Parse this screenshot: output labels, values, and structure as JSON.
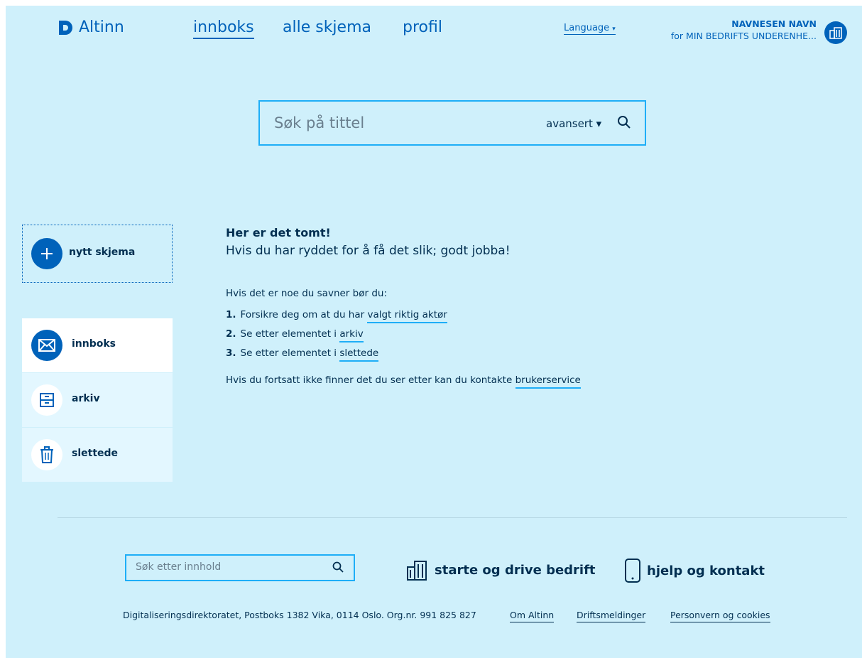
{
  "header": {
    "logo": "Altinn",
    "nav": [
      {
        "label": "innboks",
        "active": true
      },
      {
        "label": "alle skjema",
        "active": false
      },
      {
        "label": "profil",
        "active": false
      }
    ],
    "language": "Language",
    "user_name": "NAVNESEN NAVN",
    "user_org": "for MIN BEDRIFTS UNDERENHE..."
  },
  "search": {
    "placeholder": "Søk på tittel",
    "advanced": "avansert ▾"
  },
  "sidebar": {
    "new_form": "nytt skjema",
    "items": [
      {
        "label": "innboks",
        "icon": "envelope-icon"
      },
      {
        "label": "arkiv",
        "icon": "archive-icon"
      },
      {
        "label": "slettede",
        "icon": "trash-icon"
      }
    ]
  },
  "content": {
    "title": "Her er det tomt!",
    "subtitle": "Hvis du har ryddet for å få det slik; godt jobba!",
    "intro": "Hvis det er noe du savner bør du:",
    "steps": [
      {
        "num": "1.",
        "text": "Forsikre deg om at du har ",
        "link": "valgt riktig aktør"
      },
      {
        "num": "2.",
        "text": "Se etter elementet i ",
        "link": "arkiv"
      },
      {
        "num": "3.",
        "text": "Se etter elementet i ",
        "link": "slettede"
      }
    ],
    "contact_text": "Hvis du fortsatt ikke finner det du ser etter kan du kontakte ",
    "contact_link": "brukerservice"
  },
  "footer": {
    "search_placeholder": "Søk etter innhold",
    "links": [
      "starte og drive bedrift",
      "hjelp og kontakt"
    ],
    "address": "Digitaliseringsdirektoratet, Postboks 1382 Vika, 0114 Oslo. Org.nr. 991 825 827",
    "bottom_links": [
      "Om Altinn",
      "Driftsmeldinger",
      "Personvern og cookies"
    ]
  },
  "colors": {
    "background": "#cff0fb",
    "primary": "#0062ba",
    "accent": "#1eaef7",
    "text": "#022f51"
  }
}
